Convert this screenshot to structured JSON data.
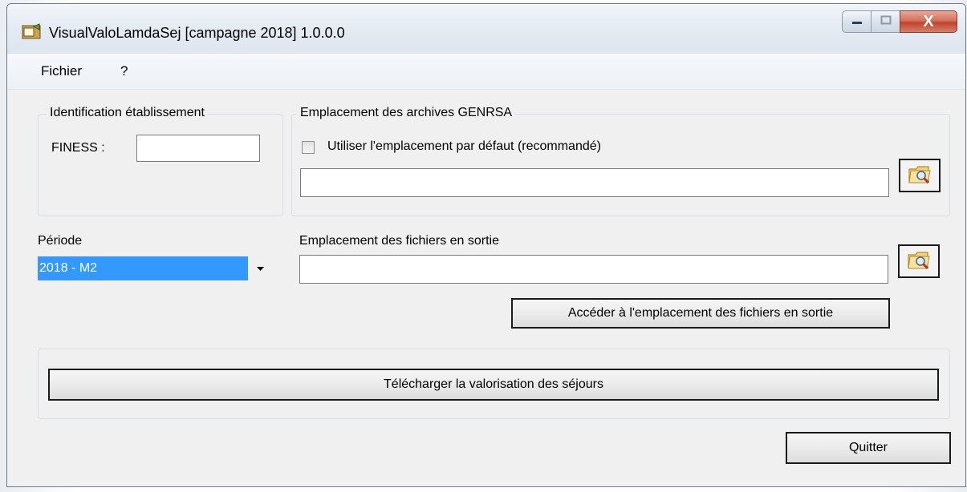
{
  "window": {
    "title": "VisualValoLamdaSej [campagne 2018] 1.0.0.0",
    "close_glyph": "X"
  },
  "menu": {
    "items": [
      "Fichier",
      "?"
    ]
  },
  "identification": {
    "legend": "Identification établissement",
    "finess_label": "FINESS :",
    "finess_value": ""
  },
  "archives": {
    "legend": "Emplacement des archives GENRSA",
    "checkbox_label": "Utiliser l'emplacement par défaut (recommandé)",
    "checkbox_checked": false,
    "path_value": ""
  },
  "periode": {
    "label": "Période",
    "selected": "2018 - M2"
  },
  "sortie": {
    "label": "Emplacement des fichiers en sortie",
    "path_value": "",
    "open_button_label": "Accéder à l'emplacement des fichiers en sortie"
  },
  "actions": {
    "download_label": "Télécharger la valorisation des séjours",
    "quit_label": "Quitter"
  },
  "icons": {
    "app": "app-window-icon",
    "minimize": "minimize-icon",
    "maximize": "maximize-icon",
    "close": "close-icon",
    "browse": "folder-search-icon",
    "dropdown": "dropdown-arrow-icon"
  },
  "colors": {
    "selection": "#3399ff",
    "close_button": "#c2432c",
    "window_bg": "#f0f0f0"
  }
}
